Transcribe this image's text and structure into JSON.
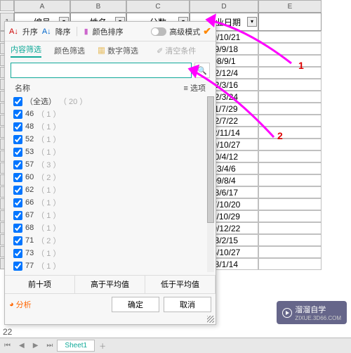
{
  "columns": {
    "A": "A",
    "B": "B",
    "C": "C",
    "D": "D",
    "E": "E"
  },
  "headers": {
    "id": "编号",
    "name": "姓名",
    "score": "分数",
    "graddate": "毕业日期"
  },
  "row1": "1",
  "dates": [
    "09/10/21",
    "09/9/18",
    "08/9/1",
    "12/12/4",
    "12/3/16",
    "12/3/24",
    "11/7/29",
    "12/7/22",
    "12/11/14",
    "09/10/27",
    "10/4/12",
    "13/4/6",
    "09/8/4",
    "08/6/17",
    "07/10/20",
    "11/10/29",
    "09/12/22",
    "13/2/15",
    "06/10/27",
    "08/1/14"
  ],
  "panel": {
    "asc": "升序",
    "desc": "降序",
    "colorSort": "颜色排序",
    "advanced": "高级模式",
    "tab_content": "内容筛选",
    "tab_color": "颜色筛选",
    "tab_number": "数字筛选",
    "clear": "清空条件",
    "name_hdr": "名称",
    "options_hdr": "选项",
    "search_placeholder": "",
    "all": "（全选）",
    "all_cnt": "（ 20 ）",
    "items": [
      {
        "v": "46",
        "c": "（ 1 ）"
      },
      {
        "v": "48",
        "c": "（ 1 ）"
      },
      {
        "v": "52",
        "c": "（ 1 ）"
      },
      {
        "v": "53",
        "c": "（ 1 ）"
      },
      {
        "v": "57",
        "c": "（ 3 ）"
      },
      {
        "v": "60",
        "c": "（ 2 ）"
      },
      {
        "v": "62",
        "c": "（ 1 ）"
      },
      {
        "v": "66",
        "c": "（ 1 ）"
      },
      {
        "v": "67",
        "c": "（ 1 ）"
      },
      {
        "v": "68",
        "c": "（ 1 ）"
      },
      {
        "v": "71",
        "c": "（ 2 ）"
      },
      {
        "v": "73",
        "c": "（ 1 ）"
      },
      {
        "v": "77",
        "c": "（ 1 ）"
      }
    ],
    "top10": "前十项",
    "above": "高于平均值",
    "below": "低于平均值",
    "analyze": "分析",
    "ok": "确定",
    "cancel": "取消"
  },
  "annotations": {
    "a1": "1",
    "a2": "2"
  },
  "sheet": {
    "name": "Sheet1",
    "r22": "22"
  },
  "watermark": {
    "main": "溜溜自学",
    "sub": "ZIXUE.3D66.COM"
  }
}
